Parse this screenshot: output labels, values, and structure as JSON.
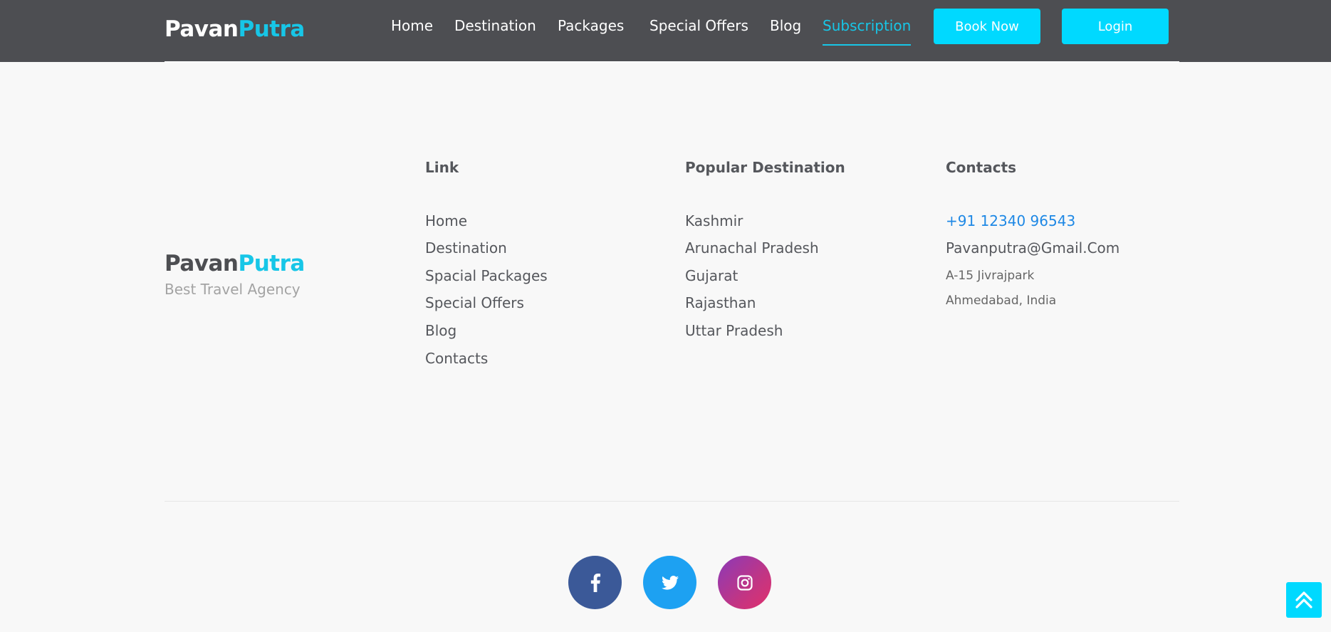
{
  "header": {
    "logo_part1": "Pavan",
    "logo_part2": "Putra",
    "nav": [
      {
        "label": "Home"
      },
      {
        "label": "Destination"
      },
      {
        "label": "Packages"
      },
      {
        "label": "Special Offers"
      },
      {
        "label": "Blog"
      },
      {
        "label": "Subscription",
        "active": true
      }
    ],
    "book_now_label": "Book Now",
    "login_label": "Login"
  },
  "footer": {
    "brand_part1": "Pavan",
    "brand_part2": "Putra",
    "tagline": "Best Travel Agency",
    "link_title": "Link",
    "links": [
      "Home",
      "Destination",
      "Spacial Packages",
      "Special Offers",
      "Blog",
      "Contacts"
    ],
    "destination_title": "Popular Destination",
    "destinations": [
      "Kashmir",
      "Arunachal Pradesh",
      "Gujarat",
      "Rajasthan",
      "Uttar Pradesh"
    ],
    "contacts_title": "Contacts",
    "phone": "+91 12340 96543",
    "email": "Pavanputra@Gmail.Com",
    "address_line1": "A-15 Jivrajpark",
    "address_line2": "Ahmedabad, India"
  },
  "social": [
    "facebook-icon",
    "twitter-icon",
    "instagram-icon"
  ],
  "colors": {
    "header_bg": "#4d4e52",
    "accent": "#17c6e7",
    "button_bg": "#00d9ff",
    "link_blue": "#1e88e5",
    "facebook": "#3b5998",
    "twitter": "#1da1f2"
  }
}
